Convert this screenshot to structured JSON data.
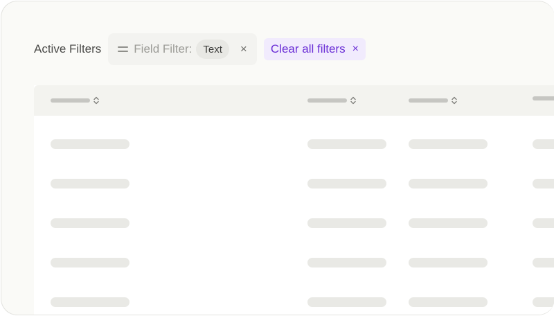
{
  "filters": {
    "active_label": "Active Filters",
    "field_filter_label": "Field Filter:",
    "field_filter_value": "Text",
    "field_filter_icon": "equals-icon",
    "remove_icon": "close-icon",
    "remove_glyph": "×",
    "clear_label": "Clear all filters",
    "clear_glyph": "×"
  },
  "colors": {
    "accent": "#6b2fd6",
    "accent_bg": "#f1ebfd",
    "skeleton": "#e9e9e5",
    "header_bg": "#f3f3ef"
  },
  "table": {
    "columns": [
      "skeleton",
      "skeleton",
      "skeleton",
      "skeleton"
    ],
    "row_count": 5,
    "sort_icon": "sort-icon"
  }
}
